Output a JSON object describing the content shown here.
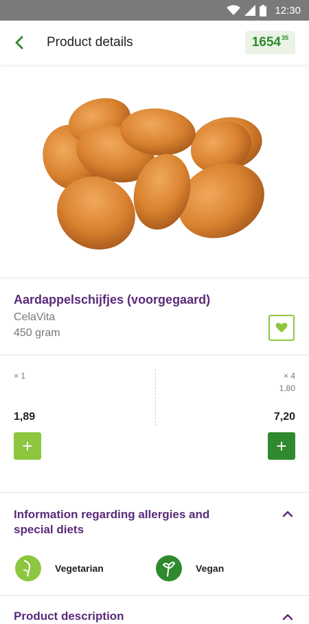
{
  "status_bar": {
    "time": "12:30"
  },
  "header": {
    "title": "Product details",
    "balance_main": "1654",
    "balance_fraction": "35"
  },
  "product": {
    "name": "Aardappelschijfjes (voorgegaard)",
    "brand": "CelaVita",
    "weight": "450 gram"
  },
  "pricing": {
    "single_qty": "× 1",
    "single_price": "1,89",
    "multi_qty": "× 4",
    "multi_unit_price": "1,80",
    "multi_price": "7,20",
    "add_label": "+"
  },
  "allergies": {
    "title_line1": "Information regarding allergies and",
    "title_line2": "special diets",
    "diets": [
      {
        "label": "Vegetarian",
        "color": "#8dc63f",
        "icon": "vegetarian-icon"
      },
      {
        "label": "Vegan",
        "color": "#2f8a2f",
        "icon": "vegan-icon"
      }
    ]
  },
  "description": {
    "title": "Product description"
  },
  "colors": {
    "accent_green": "#2f8a2f",
    "light_green": "#8dc63f",
    "purple": "#5a2a7a"
  }
}
